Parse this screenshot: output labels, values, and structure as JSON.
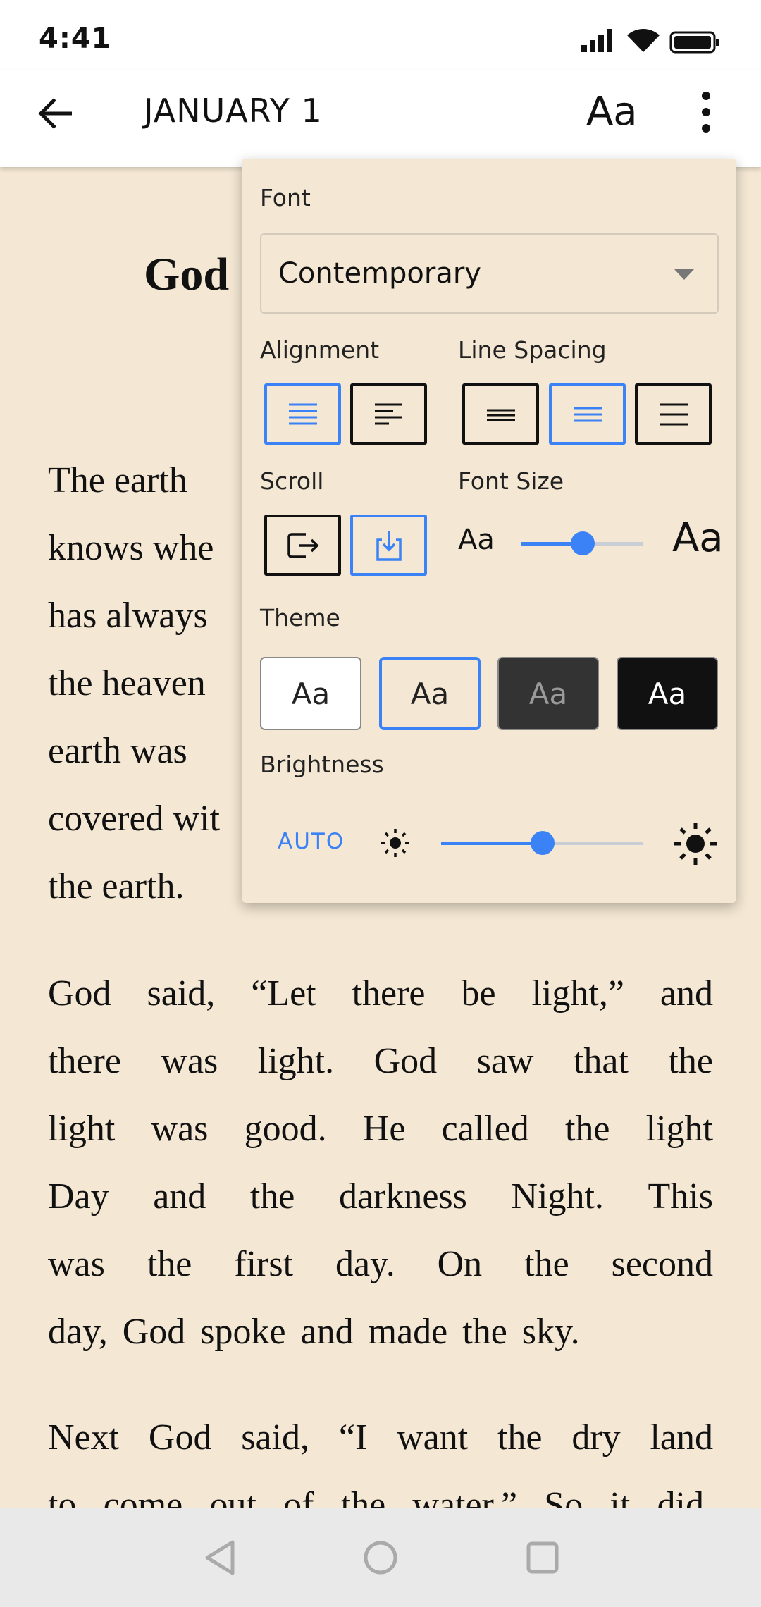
{
  "status": {
    "time": "4:41"
  },
  "header": {
    "title": "JANUARY 1",
    "font_button": "Aa",
    "back_icon": "arrow-left-icon",
    "more_icon": "more-vertical-icon"
  },
  "content": {
    "heading": "God",
    "paragraphs": [
      [
        "The earth",
        "knows whe",
        "has always",
        "the heaven",
        "earth was",
        "covered wit",
        "the earth."
      ],
      [
        "God said, “Let there be light,” and",
        "there was light. God saw that the",
        "light was good. He called the light",
        "Day and the darkness Night. This",
        "was the first day. On the second",
        "day, God spoke and made the sky."
      ],
      [
        "Next God said, “I want the dry land",
        "to come out of the water.” So it did."
      ]
    ]
  },
  "settings": {
    "font_label": "Font",
    "font_value": "Contemporary",
    "alignment_label": "Alignment",
    "alignment_selected": "justify",
    "line_spacing_label": "Line Spacing",
    "line_spacing_selected": "medium",
    "scroll_label": "Scroll",
    "scroll_selected": "vertical",
    "font_size_label": "Font Size",
    "font_size_small": "Aa",
    "font_size_large": "Aa",
    "font_size_level": 0.5,
    "theme_label": "Theme",
    "themes": [
      {
        "label": "Aa",
        "bg": "#ffffff",
        "fg": "#222222"
      },
      {
        "label": "Aa",
        "bg": "#f4e7d3",
        "fg": "#222222"
      },
      {
        "label": "Aa",
        "bg": "#333333",
        "fg": "#9a9a9a"
      },
      {
        "label": "Aa",
        "bg": "#111111",
        "fg": "#ffffff"
      }
    ],
    "theme_selected": 1,
    "brightness_label": "Brightness",
    "brightness_auto": "AUTO",
    "brightness_level": 0.5,
    "accent": "#3b82f6"
  }
}
